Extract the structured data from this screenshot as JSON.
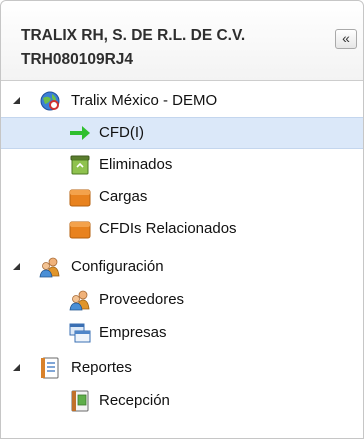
{
  "header": {
    "company_name": "TRALIX RH, S. DE R.L. DE C.V.",
    "company_rfc": "TRH080109RJ4",
    "collapse_label": "«"
  },
  "tree": {
    "root_tralix": {
      "label": "Tralix México - DEMO",
      "icon": "globe-icon",
      "children": [
        {
          "label": "CFD(I)",
          "icon": "arrow-right-icon",
          "selected": true
        },
        {
          "label": "Eliminados",
          "icon": "recycle-bin-icon"
        },
        {
          "label": "Cargas",
          "icon": "folder-icon"
        },
        {
          "label": "CFDIs Relacionados",
          "icon": "folder-icon"
        }
      ]
    },
    "root_config": {
      "label": "Configuración",
      "icon": "users-icon",
      "children": [
        {
          "label": "Proveedores",
          "icon": "users-icon"
        },
        {
          "label": "Empresas",
          "icon": "windows-icon"
        }
      ]
    },
    "root_reports": {
      "label": "Reportes",
      "icon": "report-icon",
      "children": [
        {
          "label": "Recepción",
          "icon": "report-book-icon"
        }
      ]
    }
  },
  "colors": {
    "selected_bg": "#dbe8f9",
    "arrow_green": "#2fbf2f",
    "folder_orange": "#e8821e"
  }
}
